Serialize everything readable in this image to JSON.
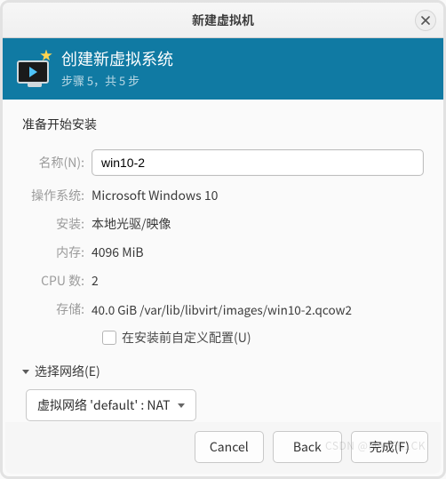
{
  "window": {
    "title": "新建虚拟机"
  },
  "banner": {
    "title": "创建新虚拟系统",
    "subtitle": "步骤 5，共 5 步"
  },
  "section": {
    "ready": "准备开始安装"
  },
  "form": {
    "name_label": "名称(N):",
    "name_value": "win10-2",
    "os_label": "操作系统:",
    "os_value": "Microsoft Windows 10",
    "install_label": "安装:",
    "install_value": "本地光驱/映像",
    "mem_label": "内存:",
    "mem_value": "4096 MiB",
    "cpu_label": "CPU 数:",
    "cpu_value": "2",
    "storage_label": "存储:",
    "storage_value": "40.0 GiB /var/lib/libvirt/images/win10-2.qcow2"
  },
  "customize": {
    "label": "在安装前自定义配置(U)",
    "checked": false
  },
  "network": {
    "header": "选择网络(E)",
    "selection": "虚拟网络 'default' : NAT"
  },
  "buttons": {
    "cancel": "Cancel",
    "back": "Back",
    "finish": "完成(F)"
  },
  "watermark": "CSDN @MAVER1CK"
}
